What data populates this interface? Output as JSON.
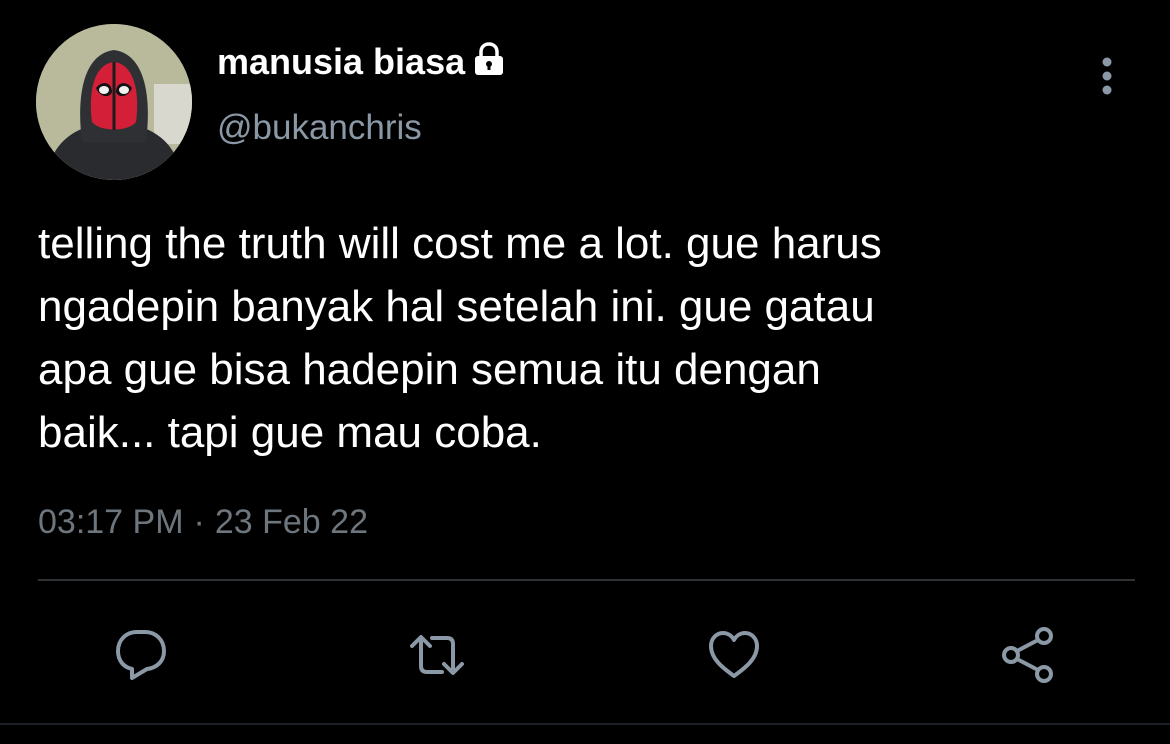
{
  "author": {
    "display_name": "manusia biasa",
    "handle": "@bukanchris",
    "avatar_icon": "deadpool-mask-avatar",
    "protected_icon": "lock-icon"
  },
  "tweet": {
    "text_lines": [
      "telling the truth will cost me a lot. gue harus",
      "ngadepin banyak hal setelah ini. gue gatau",
      "apa gue bisa hadepin semua itu dengan",
      "baik... tapi gue mau coba."
    ],
    "time": "03:17 PM",
    "separator": "·",
    "date": "23 Feb 22"
  },
  "actions": {
    "reply_icon": "reply-icon",
    "retweet_icon": "retweet-icon",
    "like_icon": "like-icon",
    "share_icon": "share-icon",
    "more_icon": "more-options-icon"
  },
  "colors": {
    "background": "#000000",
    "primary_text": "#ffffff",
    "secondary_text": "#8b98a5",
    "meta_text": "#6e767d",
    "icon": "#8b98a5",
    "divider": "#2f3336"
  }
}
